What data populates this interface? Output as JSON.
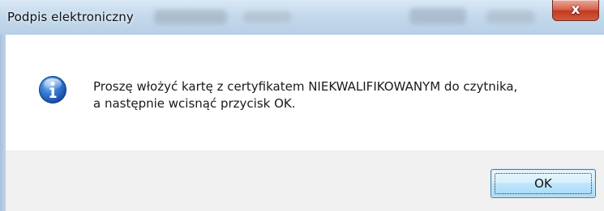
{
  "window": {
    "title": "Podpis elektroniczny"
  },
  "title_bar_buttons": {
    "close_label": "x"
  },
  "dialog": {
    "icon": "info-icon",
    "message_line_1": "Proszę włożyć kartę z certyfikatem NIEKWALIFIKOWANYM do czytnika,",
    "message_line_2": "a następnie wcisnąć przycisk OK."
  },
  "buttons": {
    "ok_label": "OK"
  },
  "colors": {
    "close_button": "#c23a20",
    "info_icon": "#1f5bb5",
    "ok_button_border": "#3c7fb1"
  }
}
